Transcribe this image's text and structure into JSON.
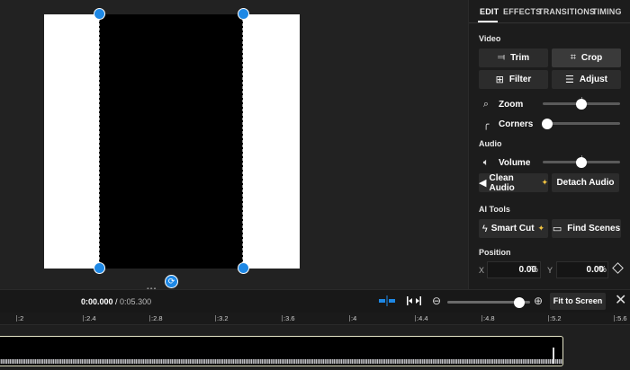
{
  "tabs": [
    "EDIT",
    "EFFECTS",
    "TRANSITIONS",
    "TIMING"
  ],
  "sections": {
    "video": "Video",
    "audio": "Audio",
    "ai_tools": "AI Tools",
    "position": "Position"
  },
  "video_buttons": {
    "trim": "Trim",
    "crop": "Crop",
    "filter": "Filter",
    "adjust": "Adjust"
  },
  "sliders": {
    "zoom_label": "Zoom",
    "corners_label": "Corners",
    "volume_label": "Volume",
    "zoom_level": 0.5,
    "corners_level": 0.0,
    "volume_level": 0.5
  },
  "audio_buttons": {
    "clean_audio": "Clean Audio",
    "detach_audio": "Detach Audio"
  },
  "ai_buttons": {
    "smart_cut": "Smart Cut",
    "find_scenes": "Find Scenes"
  },
  "position": {
    "x_label": "X",
    "x_value": "0.00",
    "y_label": "Y",
    "y_value": "0.00",
    "unit": "%"
  },
  "playback": {
    "current_time": "0:00.000",
    "separator": " / ",
    "total_time": "0:05.300",
    "fit_label": "Fit to Screen",
    "timeline_zoom_level": 0.8
  },
  "ruler_ticks": [
    ":2",
    ":2.4",
    ":2.8",
    ":3.2",
    ":3.6",
    ":4",
    ":4.4",
    ":4.8",
    ":5.2",
    ":5.6"
  ],
  "colors": {
    "accent_blue": "#1e88e5",
    "sparkle": "#f4c542",
    "clip_border": "#e6e6c8"
  }
}
